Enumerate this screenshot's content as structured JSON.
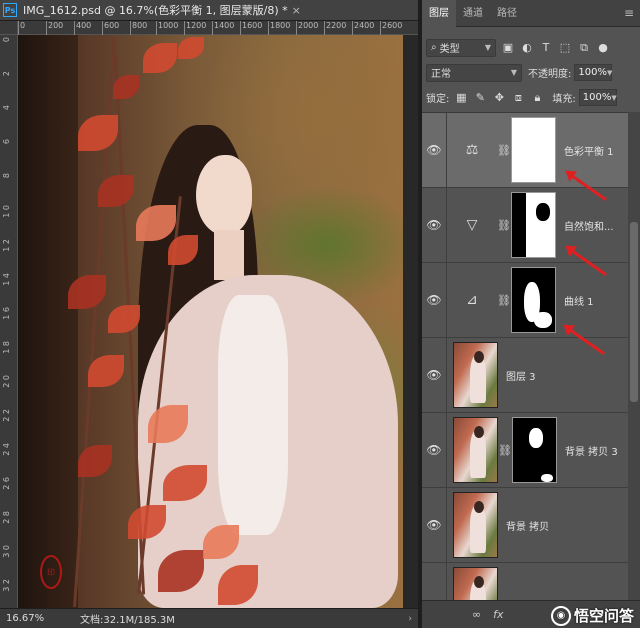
{
  "document": {
    "app_icon": "Ps",
    "title": "IMG_1612.psd @ 16.7%(色彩平衡 1, 图层蒙版/8) *",
    "close": "×",
    "ruler_top": [
      "0",
      "200",
      "400",
      "600",
      "800",
      "1000",
      "1200",
      "1400",
      "1600",
      "1800",
      "2000",
      "2200",
      "2400",
      "2600"
    ],
    "ruler_left": [
      "0",
      "2",
      "4",
      "6",
      "8",
      "1 0",
      "1 2",
      "1 4",
      "1 6",
      "1 8",
      "2 0",
      "2 2",
      "2 4",
      "2 6",
      "2 8",
      "3 0",
      "3 2"
    ],
    "zoom": "16.67%",
    "doc_info": "文档:32.1M/185.3M",
    "status_arrow": "›"
  },
  "panel": {
    "tabs": [
      "图层",
      "通道",
      "路径"
    ],
    "menu_icon": "≡",
    "filter": {
      "label": "类型",
      "icon": "search-icon"
    },
    "blend_mode": "正常",
    "opacity_label": "不透明度:",
    "opacity_value": "100%",
    "lock_label": "锁定:",
    "fill_label": "填充:",
    "fill_value": "100%",
    "layers": [
      {
        "name": "色彩平衡 1",
        "type": "adjustment",
        "icon": "balance-icon",
        "selected": true
      },
      {
        "name": "自然饱和...",
        "type": "adjustment",
        "icon": "vibrance-icon",
        "selected": false
      },
      {
        "name": "曲线 1",
        "type": "adjustment",
        "icon": "curves-icon",
        "selected": false
      },
      {
        "name": "图层 3",
        "type": "pixel",
        "selected": false
      },
      {
        "name": "背景 拷贝 3",
        "type": "pixel-mask",
        "selected": false
      },
      {
        "name": "背景 拷贝",
        "type": "pixel",
        "selected": false
      }
    ],
    "footer": {
      "link": "∞",
      "fx": "fx"
    },
    "watermark": "悟空问答"
  },
  "colors": {
    "panel_bg": "#535353",
    "selected_layer": "#6b6b6b",
    "annotation_arrow": "#e02020",
    "accent": "#31a8ff"
  }
}
